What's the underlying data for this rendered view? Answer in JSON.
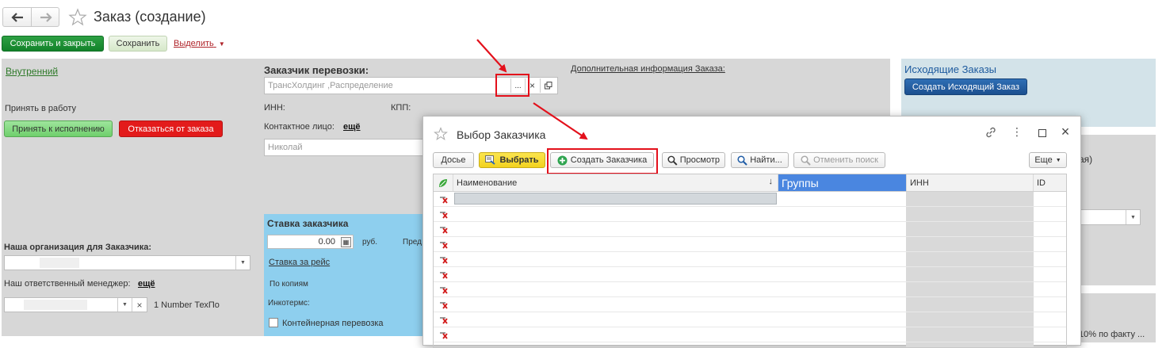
{
  "header": {
    "title": "Заказ (создание)",
    "save_close": "Сохранить и закрыть",
    "save": "Сохранить",
    "select": "Выделить"
  },
  "left": {
    "internal": "Внутренний",
    "accept_label": "Принять в работу",
    "accept_btn": "Принять к исполнению",
    "reject_btn": "Отказаться от заказа",
    "our_org_label": "Наша организация для Заказчика:",
    "manager_label": "Наш ответственный менеджер:",
    "manager_link": "ещё",
    "manager_note": "1 Number ТехПо"
  },
  "customer": {
    "title": "Заказчик перевозки:",
    "value": "ТрансХолдинг ,Распределение",
    "more": "...",
    "clear": "×",
    "inn": "ИНН:",
    "kpp": "КПП:",
    "contact_label": "Контактное лицо:",
    "contact_link": "ещё",
    "contact_placeholder": "Николай",
    "extra_info": "Дополнительная информация Заказа:"
  },
  "rate": {
    "title": "Ставка заказчика",
    "amount": "0.00",
    "currency": "руб.",
    "pred": "Пред",
    "per_trip": "Ставка за рейс",
    "copies": "По копиям",
    "incoterms": "Инкотермс:",
    "container": "Контейнерная перевозка"
  },
  "right": {
    "outgoing_title": "Исходящие Заказы",
    "create_outgoing": "Создать Исходящий Заказ",
    "partial_text": "ая)",
    "bottom_text": "10% по факту ..."
  },
  "dialog": {
    "title": "Выбор Заказчика",
    "toolbar": {
      "dossier": "Досье",
      "choose": "Выбрать",
      "create": "Создать Заказчика",
      "view": "Просмотр",
      "find": "Найти...",
      "cancel_search": "Отменить поиск",
      "more": "Еще"
    },
    "columns": {
      "name": "Наименование",
      "groups": "Группы",
      "inn": "ИНН",
      "id": "ID"
    },
    "row_count": 10
  },
  "colors": {
    "green": "#1a8f2d",
    "red": "#e31b1b",
    "blue_btn": "#1d5a9e",
    "highlight": "#e3101b",
    "groups_header": "#4a86e0",
    "rate_panel": "#8ecfee"
  }
}
